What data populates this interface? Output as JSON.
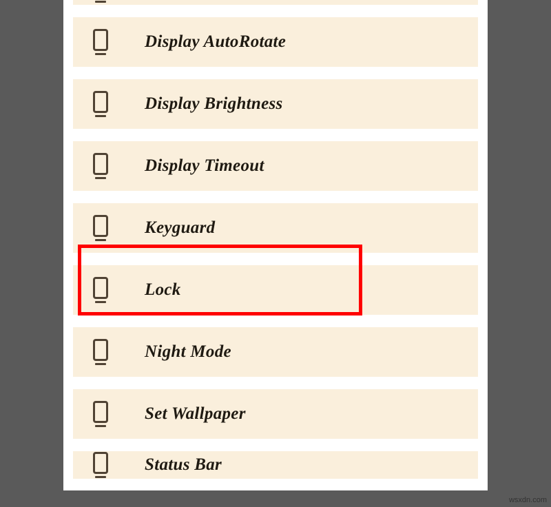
{
  "list": {
    "items": [
      {
        "label": ""
      },
      {
        "label": "Display AutoRotate"
      },
      {
        "label": "Display Brightness"
      },
      {
        "label": "Display Timeout"
      },
      {
        "label": "Keyguard"
      },
      {
        "label": "Lock"
      },
      {
        "label": "Night Mode"
      },
      {
        "label": "Set Wallpaper"
      },
      {
        "label": "Status Bar"
      }
    ]
  },
  "watermark": "wsxdn.com"
}
